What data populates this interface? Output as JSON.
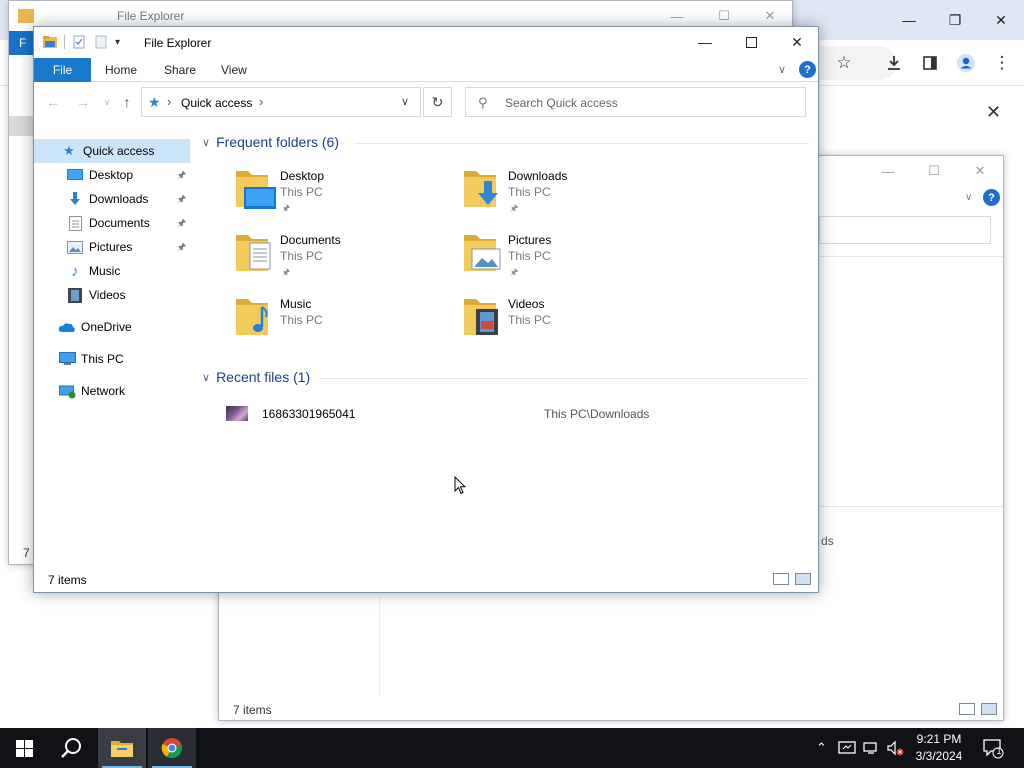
{
  "explorer": {
    "title": "File Explorer",
    "ribbon_tabs": {
      "file": "File",
      "home": "Home",
      "share": "Share",
      "view": "View"
    },
    "help": "?",
    "address": {
      "location": "Quick access"
    },
    "search": {
      "placeholder": "Search Quick access"
    },
    "sidebar": {
      "quick_access": "Quick access",
      "desktop": "Desktop",
      "downloads": "Downloads",
      "documents": "Documents",
      "pictures": "Pictures",
      "music": "Music",
      "videos": "Videos",
      "onedrive": "OneDrive",
      "this_pc": "This PC",
      "network": "Network"
    },
    "frequent": {
      "header": "Frequent folders (6)",
      "folders": [
        {
          "name": "Desktop",
          "location": "This PC"
        },
        {
          "name": "Downloads",
          "location": "This PC"
        },
        {
          "name": "Documents",
          "location": "This PC"
        },
        {
          "name": "Pictures",
          "location": "This PC"
        },
        {
          "name": "Music",
          "location": "This PC"
        },
        {
          "name": "Videos",
          "location": "This PC"
        }
      ]
    },
    "recent": {
      "header": "Recent files (1)",
      "files": [
        {
          "name": "16863301965041",
          "path": "This PC\\Downloads"
        }
      ]
    },
    "status": "7 items"
  },
  "back_explorer_1": {
    "title": "File Explorer",
    "ribbon_letter": "F",
    "status": "7 i"
  },
  "back_explorer_2": {
    "status": "7 items",
    "partial_text": "ds",
    "help": "?"
  },
  "taskbar": {
    "time": "9:21 PM",
    "date": "3/3/2024",
    "notification_count": "1"
  },
  "colors": {
    "accent": "#1979ca",
    "selection": "#cce4f7",
    "section_header": "#1c3d8f",
    "taskbar": "#101216"
  }
}
